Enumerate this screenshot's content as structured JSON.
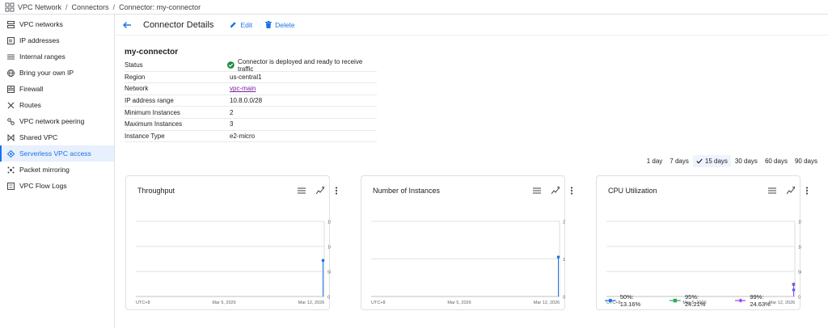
{
  "topbar": {
    "breadcrumbs": [
      "VPC Network",
      "Connectors",
      "Connector: my-connector"
    ]
  },
  "sidebar": {
    "items": [
      {
        "label": "VPC networks",
        "icon": "vpc-networks-icon"
      },
      {
        "label": "IP addresses",
        "icon": "ip-addresses-icon"
      },
      {
        "label": "Internal ranges",
        "icon": "internal-ranges-icon"
      },
      {
        "label": "Bring your own IP",
        "icon": "globe-icon"
      },
      {
        "label": "Firewall",
        "icon": "firewall-icon"
      },
      {
        "label": "Routes",
        "icon": "routes-icon"
      },
      {
        "label": "VPC network peering",
        "icon": "peering-icon"
      },
      {
        "label": "Shared VPC",
        "icon": "shared-vpc-icon"
      },
      {
        "label": "Serverless VPC access",
        "icon": "serverless-icon",
        "active": true
      },
      {
        "label": "Packet mirroring",
        "icon": "packet-mirroring-icon"
      },
      {
        "label": "VPC Flow Logs",
        "icon": "flow-logs-icon"
      }
    ]
  },
  "header": {
    "title": "Connector Details",
    "edit_label": "Edit",
    "delete_label": "Delete"
  },
  "connector": {
    "name": "my-connector",
    "details": [
      {
        "key": "Status",
        "value": "Connector is deployed and ready to receive traffic",
        "status": true
      },
      {
        "key": "Region",
        "value": "us-central1"
      },
      {
        "key": "Network",
        "value": "vpc-main",
        "link": true
      },
      {
        "key": "IP address range",
        "value": "10.8.0.0/28"
      },
      {
        "key": "Minimum Instances",
        "value": "2"
      },
      {
        "key": "Maximum Instances",
        "value": "3"
      },
      {
        "key": "Instance Type",
        "value": "e2-micro"
      }
    ]
  },
  "time_ranges": {
    "options": [
      "1 day",
      "7 days",
      "15 days",
      "30 days",
      "60 days",
      "90 days"
    ],
    "selected": "15 days"
  },
  "colors": {
    "accent": "#1a73e8",
    "status_ok": "#1e8e3e",
    "link": "#7b1fa2",
    "series_50": "#1a73e8",
    "series_95": "#34a853",
    "series_99": "#a142f4"
  },
  "chart_data": [
    {
      "type": "line",
      "title": "Throughput",
      "x_ticks": [
        "UTC+8",
        "Mar 5, 2026",
        "Mar 12, 2026"
      ],
      "y_ticks": [
        "150B/s",
        "100B/s",
        "50B/s",
        "0"
      ],
      "ylim": [
        0,
        150
      ],
      "series": [
        {
          "points": [
            {
              "x": "Mar 12, 2026",
              "y": 72
            }
          ]
        }
      ]
    },
    {
      "type": "line",
      "title": "Number of Instances",
      "x_ticks": [
        "UTC+8",
        "Mar 5, 2026",
        "Mar 12, 2026"
      ],
      "y_ticks": [
        "2",
        "1",
        "0"
      ],
      "ylim": [
        0,
        2
      ],
      "series": [
        {
          "points": [
            {
              "x": "Mar 12, 2026",
              "y": 1.05
            }
          ]
        }
      ]
    },
    {
      "type": "line",
      "title": "CPU Utilization",
      "x_ticks": [
        "UTC+8",
        "Mar 5, 2026",
        "Mar 12, 2026"
      ],
      "y_ticks": [
        "150%",
        "100%",
        "50%",
        "0"
      ],
      "ylim": [
        0,
        150
      ],
      "series": [
        {
          "name": "50%: 13.16%",
          "color": "#1a73e8",
          "marker": "circle",
          "points": [
            {
              "x": "Mar 12, 2026",
              "y": 13.16
            }
          ]
        },
        {
          "name": "95%: 24.21%",
          "color": "#34a853",
          "marker": "square",
          "points": [
            {
              "x": "Mar 12, 2026",
              "y": 24.21
            }
          ]
        },
        {
          "name": "99%: 24.63%",
          "color": "#a142f4",
          "marker": "diamond",
          "points": [
            {
              "x": "Mar 12, 2026",
              "y": 24.63
            }
          ]
        }
      ]
    }
  ]
}
